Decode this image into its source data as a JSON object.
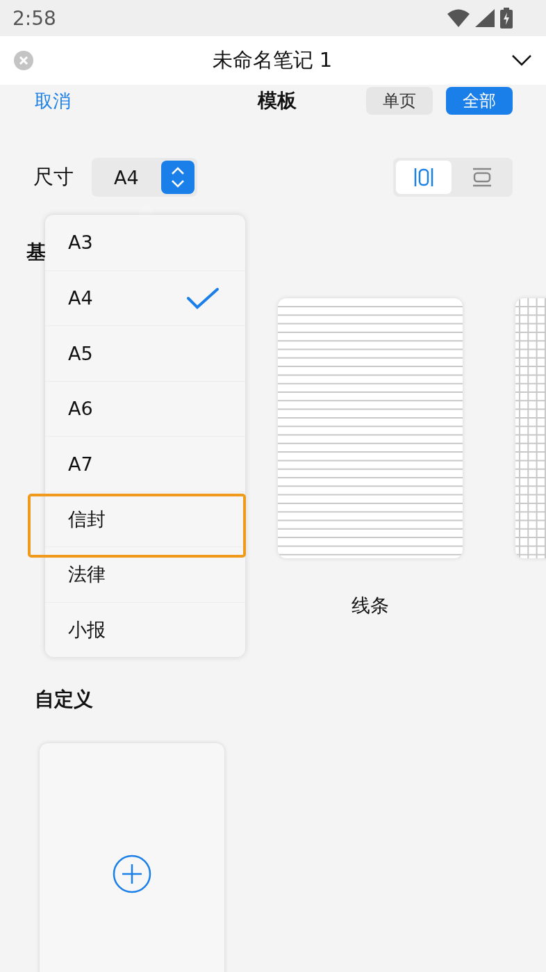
{
  "status_bar": {
    "time": "2:58"
  },
  "title_bar": {
    "title": "未命名笔记 1"
  },
  "sheet_header": {
    "cancel": "取消",
    "title": "模板",
    "segments": [
      {
        "label": "单页",
        "selected": false
      },
      {
        "label": "全部",
        "selected": true
      }
    ]
  },
  "size_row": {
    "label": "尺寸",
    "value": "A4",
    "orientations": [
      {
        "kind": "portrait",
        "selected": true
      },
      {
        "kind": "landscape",
        "selected": false
      }
    ]
  },
  "size_menu": [
    {
      "label": "A3",
      "selected": false,
      "annotated": false
    },
    {
      "label": "A4",
      "selected": true,
      "annotated": false
    },
    {
      "label": "A5",
      "selected": false,
      "annotated": false
    },
    {
      "label": "A6",
      "selected": false,
      "annotated": false
    },
    {
      "label": "A7",
      "selected": false,
      "annotated": false
    },
    {
      "label": "信封",
      "selected": false,
      "annotated": true
    },
    {
      "label": "法律",
      "selected": false,
      "annotated": false
    },
    {
      "label": "小报",
      "selected": false,
      "annotated": false
    }
  ],
  "basic_section": {
    "title_fragment": "基",
    "templates": [
      {
        "kind": "lined",
        "label": "线条"
      },
      {
        "kind": "grid"
      }
    ]
  },
  "custom_section": {
    "title": "自定义"
  }
}
